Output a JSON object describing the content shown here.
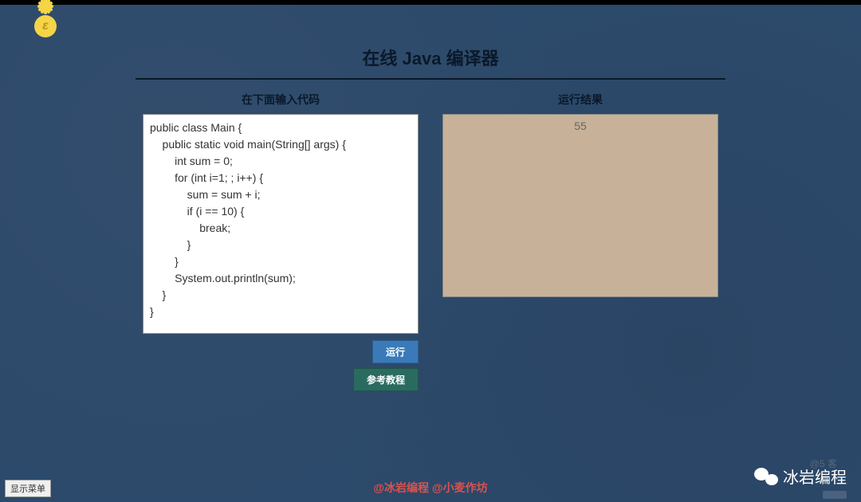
{
  "header": {
    "logo_letter": "ε"
  },
  "main": {
    "title": "在线 Java 编译器",
    "input_label": "在下面输入代码",
    "output_label": "运行结果",
    "code": "public class Main {\n    public static void main(String[] args) {\n        int sum = 0;\n        for (int i=1; ; i++) {\n            sum = sum + i;\n            if (i == 10) {\n                break;\n            }\n        }\n        System.out.println(sum);\n    }\n}",
    "output": "55",
    "run_button": "运行",
    "tutorial_button": "参考教程"
  },
  "footer": {
    "credits": "@冰岩编程 @小麦作坊",
    "menu_button": "显示菜单",
    "wechat_name": "冰岩编程",
    "faded_credit": "@5          客"
  }
}
